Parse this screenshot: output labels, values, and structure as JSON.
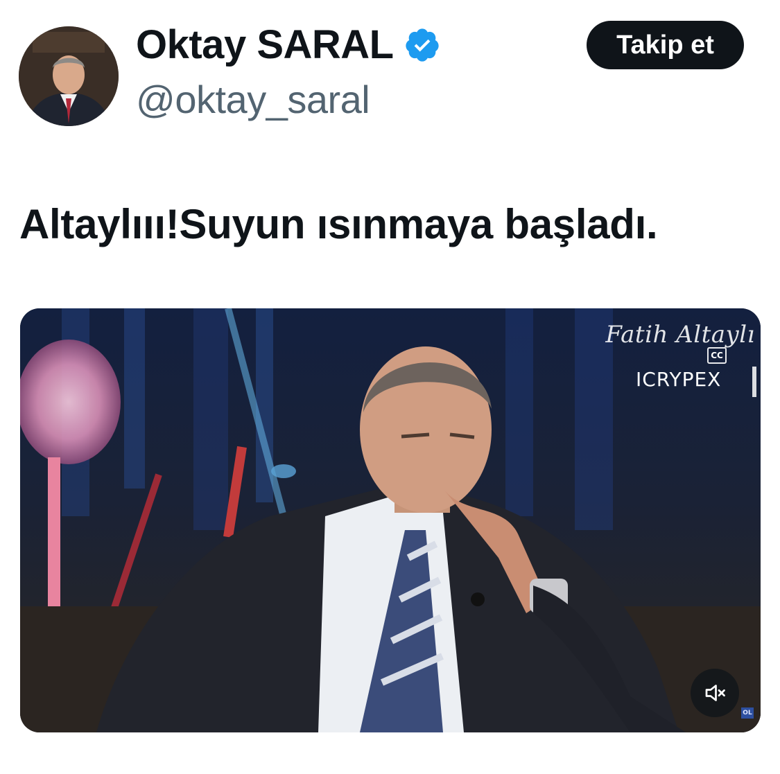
{
  "author": {
    "display_name": "Oktay SARAL",
    "handle": "@oktay_saral",
    "verified": true,
    "verified_color": "#1d9bf0"
  },
  "follow_button": {
    "label": "Takip et"
  },
  "tweet": {
    "text": "Altaylııı!Suyun ısınmaya başladı."
  },
  "media": {
    "type": "video",
    "watermark_name": "Fatih Altaylı",
    "cc_label": "CC",
    "sponsor": "ICRYPEX",
    "corner_badge": "OL",
    "muted": true,
    "mute_icon": "speaker-muted-icon"
  },
  "colors": {
    "text_primary": "#0f1419",
    "text_secondary": "#536471",
    "button_bg": "#0f1419",
    "button_text": "#ffffff"
  }
}
